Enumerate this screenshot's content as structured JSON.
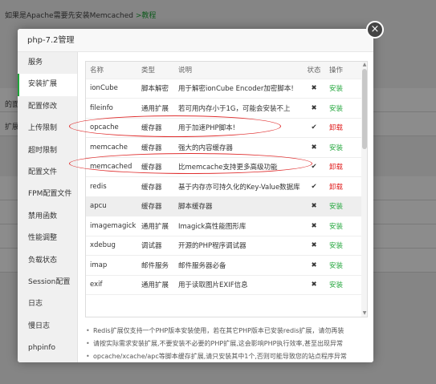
{
  "background": {
    "top_text": "如果是Apache需要先安装Memcached",
    "top_link": ">教程",
    "side_fragment_1": "的面板",
    "side_fragment_2": "扩展)"
  },
  "modal": {
    "title": "php-7.2管理",
    "close_label": "×",
    "sidebar": [
      {
        "label": "服务",
        "active": false
      },
      {
        "label": "安装扩展",
        "active": true
      },
      {
        "label": "配置修改",
        "active": false
      },
      {
        "label": "上传限制",
        "active": false
      },
      {
        "label": "超时限制",
        "active": false
      },
      {
        "label": "配置文件",
        "active": false
      },
      {
        "label": "FPM配置文件",
        "active": false
      },
      {
        "label": "禁用函数",
        "active": false
      },
      {
        "label": "性能调整",
        "active": false
      },
      {
        "label": "负载状态",
        "active": false
      },
      {
        "label": "Session配置",
        "active": false
      },
      {
        "label": "日志",
        "active": false
      },
      {
        "label": "慢日志",
        "active": false
      },
      {
        "label": "phpinfo",
        "active": false
      }
    ],
    "table": {
      "headers": [
        "名称",
        "类型",
        "说明",
        "状态",
        "操作"
      ],
      "rows": [
        {
          "name": "ionCube",
          "type": "脚本解密",
          "desc": "用于解密ionCube Encoder加密脚本!",
          "status": "✖",
          "op": "安装"
        },
        {
          "name": "fileinfo",
          "type": "通用扩展",
          "desc": "若可用内存小于1G，可能会安装不上",
          "status": "✖",
          "op": "安装"
        },
        {
          "name": "opcache",
          "type": "缓存器",
          "desc": "用于加速PHP脚本!",
          "status": "✔",
          "op": "卸载"
        },
        {
          "name": "memcache",
          "type": "缓存器",
          "desc": "强大的内容缓存器",
          "status": "✖",
          "op": "安装"
        },
        {
          "name": "memcached",
          "type": "缓存器",
          "desc": "比memcache支持更多高级功能",
          "status": "✔",
          "op": "卸载"
        },
        {
          "name": "redis",
          "type": "缓存器",
          "desc": "基于内存亦可持久化的Key-Value数据库",
          "status": "✔",
          "op": "卸载"
        },
        {
          "name": "apcu",
          "type": "缓存器",
          "desc": "脚本缓存器",
          "status": "✖",
          "op": "安装"
        },
        {
          "name": "imagemagick",
          "type": "通用扩展",
          "desc": "Imagick高性能图形库",
          "status": "✖",
          "op": "安装"
        },
        {
          "name": "xdebug",
          "type": "调试器",
          "desc": "开源的PHP程序调试器",
          "status": "✖",
          "op": "安装"
        },
        {
          "name": "imap",
          "type": "邮件服务",
          "desc": "邮件服务器必备",
          "status": "✖",
          "op": "安装"
        },
        {
          "name": "exif",
          "type": "通用扩展",
          "desc": "用于读取图片EXIF信息",
          "status": "✖",
          "op": "安装"
        }
      ]
    },
    "notes": [
      "Redis扩展仅支持一个PHP版本安装使用，若在其它PHP版本已安装redis扩展，请勿再装",
      "请按实际需求安装扩展,不要安装不必要的PHP扩展,这会影响PHP执行效率,甚至出现异常",
      "opcache/xcache/apc等脚本缓存扩展,请只安装其中1个,否则可能导致您的站点程序异常"
    ]
  },
  "colors": {
    "accent_green": "#20a53a",
    "danger_red": "#e02020",
    "annotation_red": "#e03030"
  }
}
